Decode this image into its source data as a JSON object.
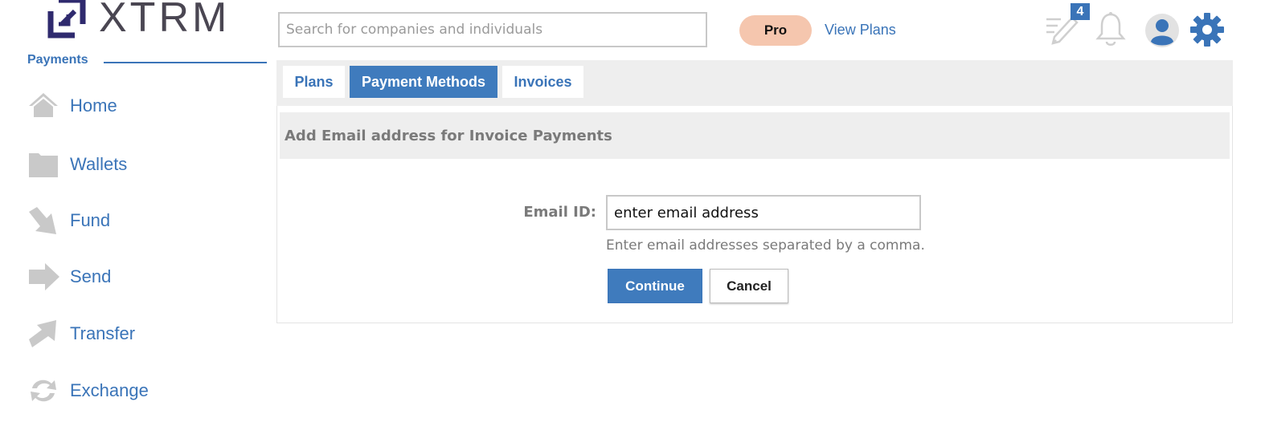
{
  "brand": {
    "name": "XTRM",
    "logo_color": "#2f2a6e"
  },
  "sidebar": {
    "section_label": "Payments",
    "items": [
      {
        "label": "Home",
        "icon": "home-icon"
      },
      {
        "label": "Wallets",
        "icon": "folder-icon"
      },
      {
        "label": "Fund",
        "icon": "arrow-down-right-icon"
      },
      {
        "label": "Send",
        "icon": "arrow-right-icon"
      },
      {
        "label": "Transfer",
        "icon": "arrow-up-right-icon"
      },
      {
        "label": "Exchange",
        "icon": "exchange-icon"
      }
    ]
  },
  "header": {
    "search_placeholder": "Search for companies and individuals",
    "plan_badge": "Pro",
    "view_plans_label": "View Plans",
    "notification_count": "4",
    "icons": [
      "edit-icon",
      "bell-icon",
      "user-avatar-icon",
      "gear-icon"
    ]
  },
  "tabs": [
    {
      "label": "Plans",
      "active": false
    },
    {
      "label": "Payment Methods",
      "active": true
    },
    {
      "label": "Invoices",
      "active": false
    }
  ],
  "form": {
    "section_title": "Add Email address for Invoice Payments",
    "email_label": "Email ID:",
    "email_value": "enter email address",
    "help_text": "Enter email addresses separated by a comma.",
    "continue_label": "Continue",
    "cancel_label": "Cancel"
  },
  "colors": {
    "accent": "#3a74b8",
    "primary_button": "#3f7bbd",
    "pro_badge": "#f5c6ae",
    "panel_gray": "#eeeeee",
    "icon_gray": "#c9c9c9"
  }
}
